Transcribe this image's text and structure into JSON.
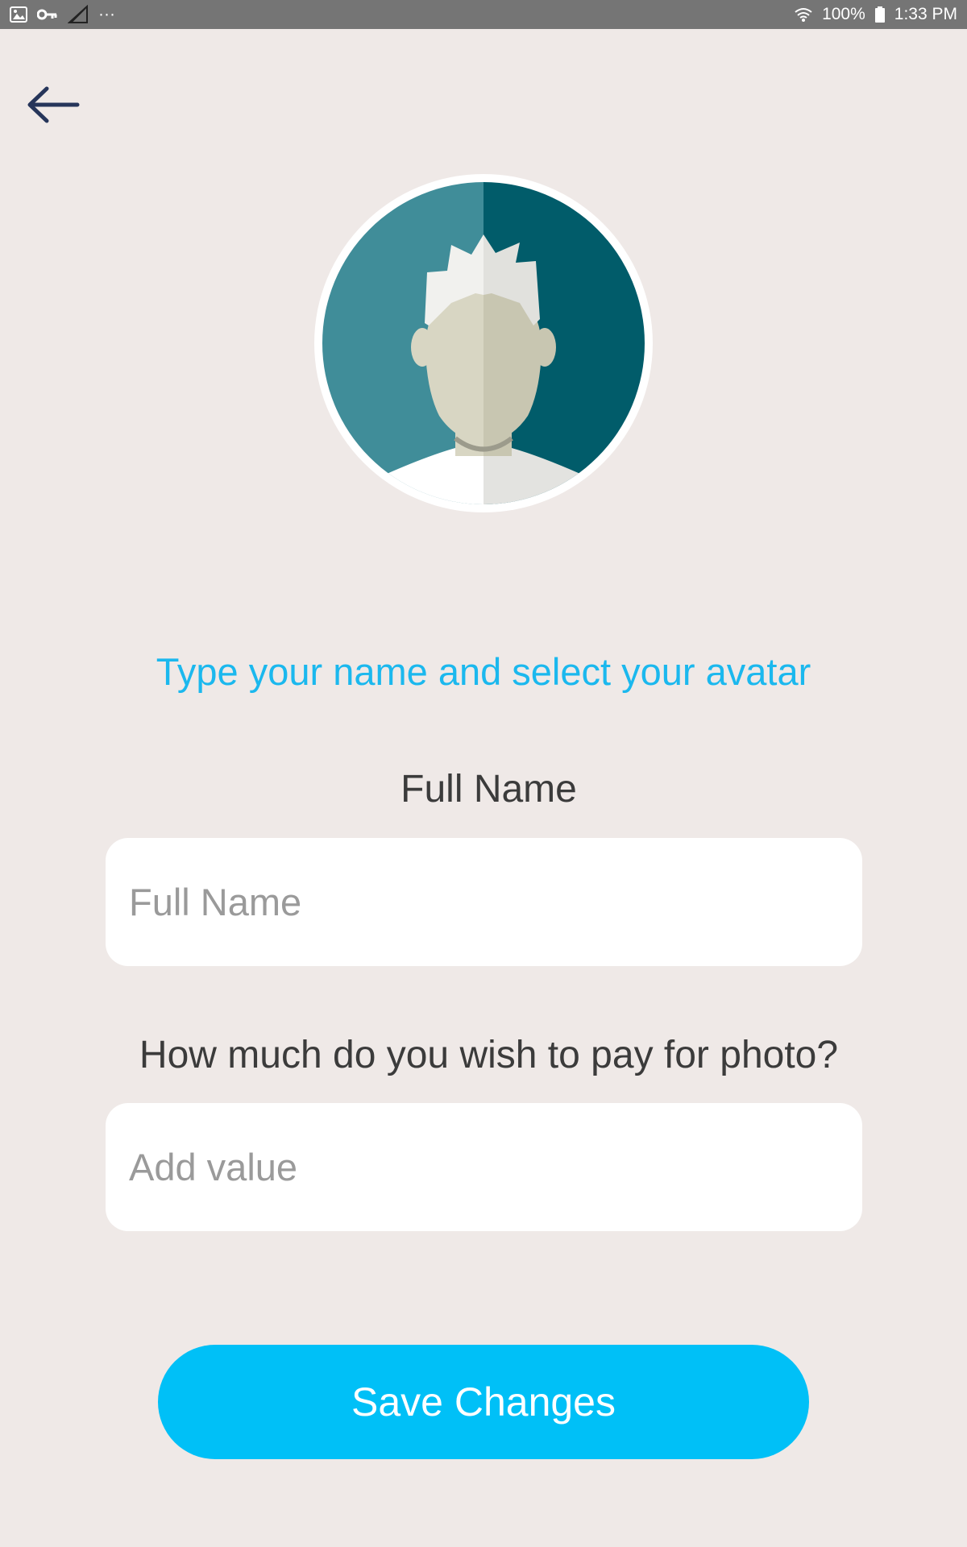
{
  "status_bar": {
    "icons_left": [
      "image-icon",
      "key-icon",
      "signal-off-icon",
      "more-icon"
    ],
    "more_label": "···",
    "battery_percent": "100%",
    "time": "1:33 PM"
  },
  "header": {
    "back_icon": "arrow-left-icon"
  },
  "avatar": {
    "icon": "default-user-avatar",
    "colors": {
      "left": "#408d99",
      "right": "#015c6a",
      "face_light": "#d8d6c3",
      "face_dark": "#c8c6b1",
      "hair_light": "#f1f1ee",
      "hair_dark": "#e1e1dd"
    }
  },
  "form": {
    "prompt": "Type your name and select your avatar",
    "full_name_label": "Full Name",
    "full_name_placeholder": "Full Name",
    "full_name_value": "",
    "pay_label": "How much do you wish to pay for photo?",
    "pay_placeholder": "Add value",
    "pay_value": ""
  },
  "actions": {
    "save_label": "Save Changes"
  },
  "colors": {
    "background": "#efe9e7",
    "accent": "#00c0f7",
    "prompt_text": "#1bb8ee",
    "status_bar": "#757575",
    "back_arrow": "#26355a"
  }
}
